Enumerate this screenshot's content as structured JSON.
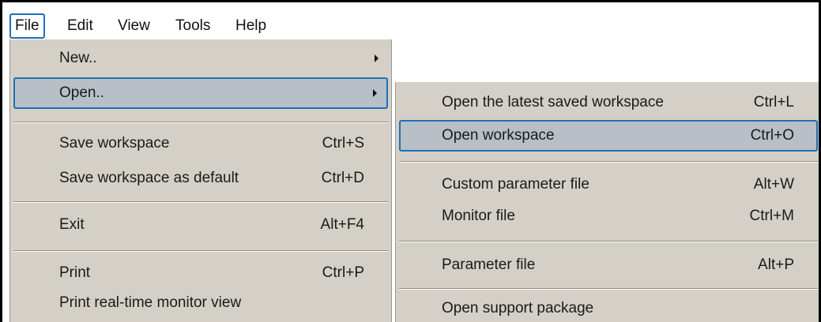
{
  "menubar": {
    "items": [
      {
        "label": "File"
      },
      {
        "label": "Edit"
      },
      {
        "label": "View"
      },
      {
        "label": "Tools"
      },
      {
        "label": "Help"
      }
    ]
  },
  "file_menu": {
    "items": [
      {
        "label": "New..",
        "shortcut": "",
        "has_submenu": true
      },
      {
        "label": "Open..",
        "shortcut": "",
        "has_submenu": true,
        "highlighted": true
      },
      {
        "label": "Save workspace",
        "shortcut": "Ctrl+S"
      },
      {
        "label": "Save workspace as default",
        "shortcut": "Ctrl+D"
      },
      {
        "label": "Exit",
        "shortcut": "Alt+F4"
      },
      {
        "label": "Print",
        "shortcut": "Ctrl+P"
      },
      {
        "label": "Print real-time monitor view",
        "shortcut": ""
      }
    ]
  },
  "open_submenu": {
    "items": [
      {
        "label": "Open the latest saved workspace",
        "shortcut": "Ctrl+L"
      },
      {
        "label": "Open workspace",
        "shortcut": "Ctrl+O",
        "highlighted": true
      },
      {
        "label": "Custom parameter file",
        "shortcut": "Alt+W"
      },
      {
        "label": "Monitor file",
        "shortcut": "Ctrl+M"
      },
      {
        "label": "Parameter file",
        "shortcut": "Alt+P"
      },
      {
        "label": "Open support package",
        "shortcut": ""
      }
    ]
  },
  "colors": {
    "menu_background": "#d4d0c8",
    "highlight_background": "#b9bfc6",
    "highlight_border": "#1f6fb5"
  }
}
